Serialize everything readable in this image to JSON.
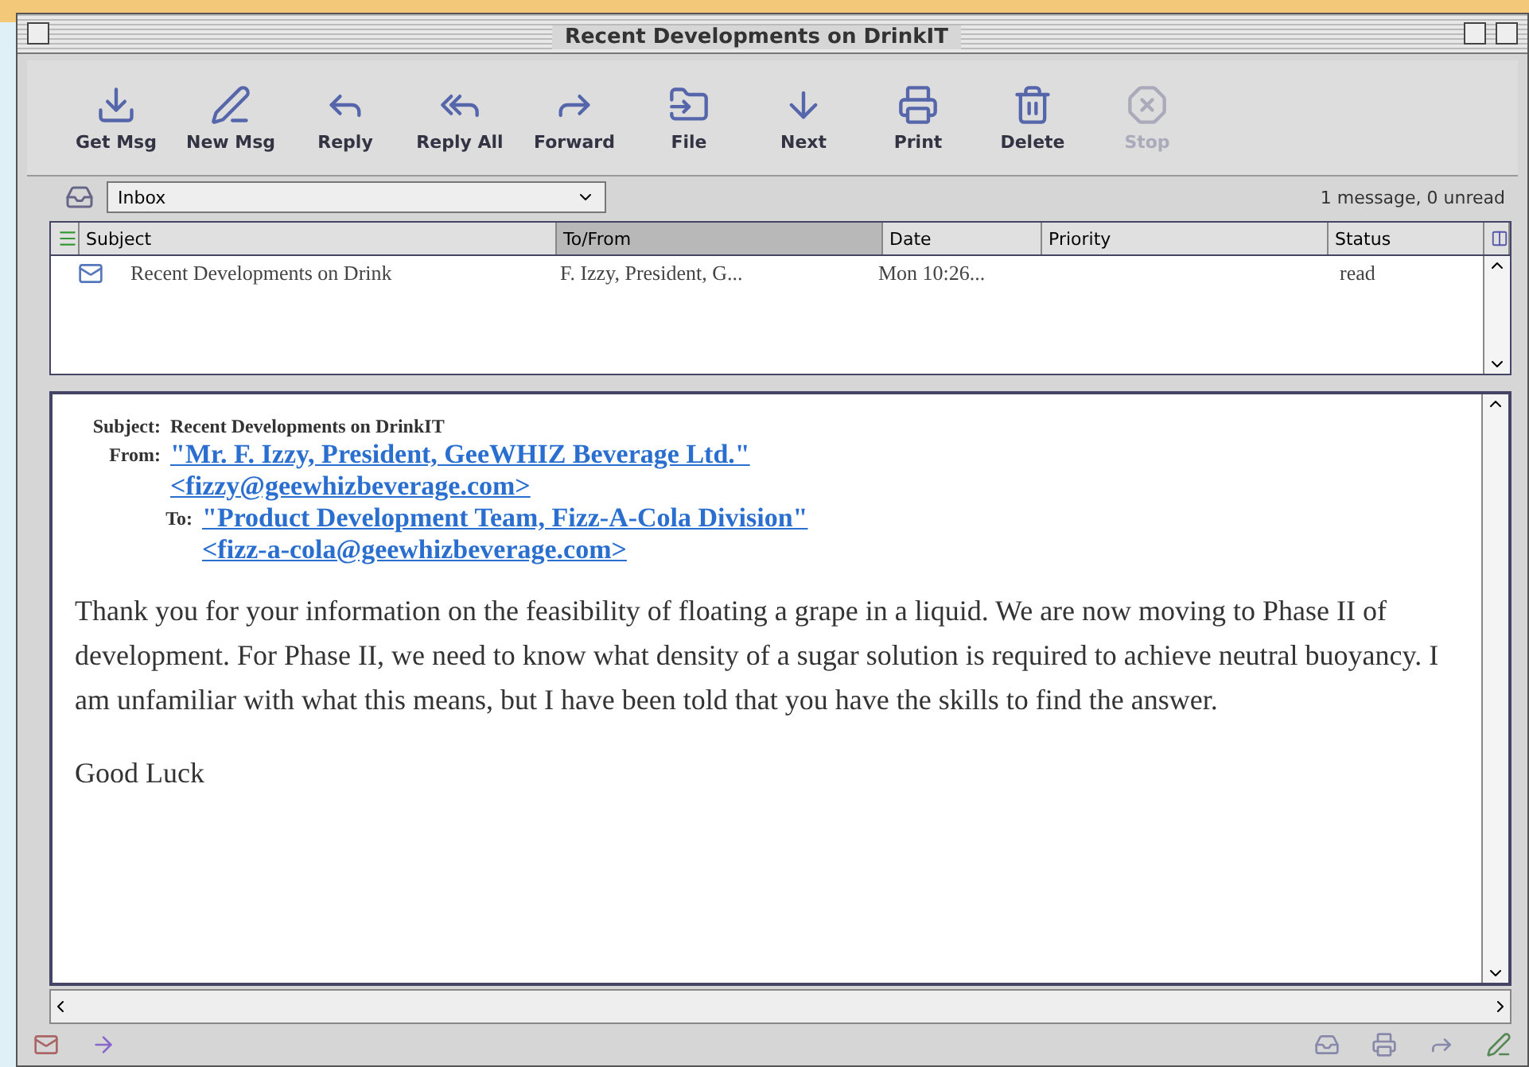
{
  "window": {
    "title": "Recent Developments on DrinkIT"
  },
  "toolbar": [
    {
      "label": "Get Msg",
      "disabled": false
    },
    {
      "label": "New Msg",
      "disabled": false
    },
    {
      "label": "Reply",
      "disabled": false
    },
    {
      "label": "Reply All",
      "disabled": false
    },
    {
      "label": "Forward",
      "disabled": false
    },
    {
      "label": "File",
      "disabled": false
    },
    {
      "label": "Next",
      "disabled": false
    },
    {
      "label": "Print",
      "disabled": false
    },
    {
      "label": "Delete",
      "disabled": false
    },
    {
      "label": "Stop",
      "disabled": true
    }
  ],
  "folder": {
    "value": "Inbox",
    "summary": "1 message, 0 unread"
  },
  "table": {
    "columns": [
      {
        "label": "Subject",
        "sorted": false
      },
      {
        "label": "To/From",
        "sorted": true
      },
      {
        "label": "Date",
        "sorted": false
      },
      {
        "label": "Priority",
        "sorted": false
      },
      {
        "label": "Status",
        "sorted": false
      }
    ],
    "rows": [
      {
        "subject": "Recent Developments on Drink",
        "from": "F. Izzy, President, G...",
        "date": "Mon 10:26...",
        "priority": "",
        "status": "read",
        "selected": false
      }
    ]
  },
  "message": {
    "subject_label": "Subject:",
    "subject": "Recent Developments on DrinkIT",
    "from_label": "From:",
    "from_name": "\"Mr. F. Izzy, President, GeeWHIZ Beverage Ltd.\"",
    "from_email": "<fizzy@geewhizbeverage.com>",
    "to_label": "To:",
    "to_name": "\"Product Development Team, Fizz-A-Cola Division\"",
    "to_email": "<fizz-a-cola@geewhizbeverage.com>",
    "body": [
      "Thank you for your information on the feasibility of floating a grape in a liquid. We are now moving to Phase II of development.  For Phase II, we need to know what density of a sugar solution is required to achieve neutral buoyancy.  I am unfamiliar with what this means, but I have been told that you have the skills to find the answer.",
      "Good Luck"
    ]
  }
}
